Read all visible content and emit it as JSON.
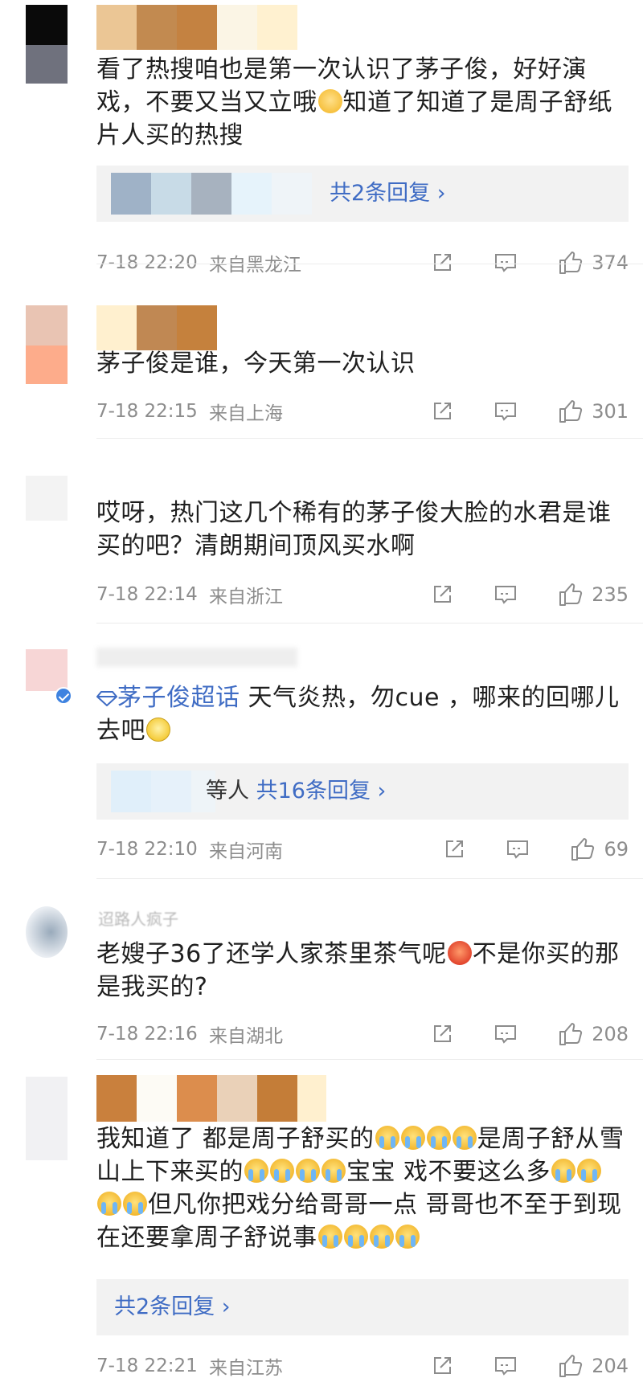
{
  "icons": {
    "share": "share-icon",
    "comment": "comment-icon",
    "like": "thumbs-up-icon",
    "verified": "verified-badge-icon",
    "supertopic": "diamond-icon"
  },
  "colors": {
    "link": "#3f6cc4",
    "meta": "#8c8c8c",
    "reply_bg": "#f2f2f2"
  },
  "comments": [
    {
      "nickname": "",
      "text": "看了热搜咱也是第一次认识了茅子俊，好好演戏，不要又当又立哦",
      "emoji1": "shy-emoji",
      "text_after": "知道了知道了是周子舒纸片人买的热搜",
      "reply_label": "共2条回复 ›",
      "time": "7-18 22:20",
      "location": "来自黑龙江",
      "likes": "374"
    },
    {
      "nickname": "",
      "text": "茅子俊是谁，今天第一次认识",
      "time": "7-18 22:15",
      "location": "来自上海",
      "likes": "301"
    },
    {
      "nickname": "",
      "text": "哎呀，热门这几个稀有的茅子俊大脸的水君是谁买的吧？清朗期间顶风买水啊",
      "time": "7-18 22:14",
      "location": "来自浙江",
      "likes": "235"
    },
    {
      "nickname": "",
      "supertopic": "茅子俊超话",
      "text": " 天气炎热，勿cue ，哪来的回哪儿去吧",
      "emoji1": "smile-emoji",
      "reply_prefix": "等人",
      "reply_label": "共16条回复 ›",
      "time": "7-18 22:10",
      "location": "来自河南",
      "likes": "69"
    },
    {
      "nickname": "迢路人疯子",
      "text": "老嫂子36了还学人家茶里茶气呢",
      "emoji1": "angry-emoji",
      "text_after": "不是你买的那是我买的?",
      "time": "7-18 22:16",
      "location": "来自湖北",
      "likes": "208"
    },
    {
      "nickname": "",
      "text_a": "我知道了 都是周子舒买的",
      "text_b": "是周子舒从雪山上下来买的",
      "text_c": "宝宝 戏不要这么多",
      "text_d": "但凡你把戏分给哥哥一点 哥哥也不至于到现在还要拿周子舒说事",
      "emoji": "crying-emoji",
      "reply_label": "共2条回复 ›",
      "time": "7-18 22:21",
      "location": "来自江苏",
      "likes": "204"
    }
  ]
}
